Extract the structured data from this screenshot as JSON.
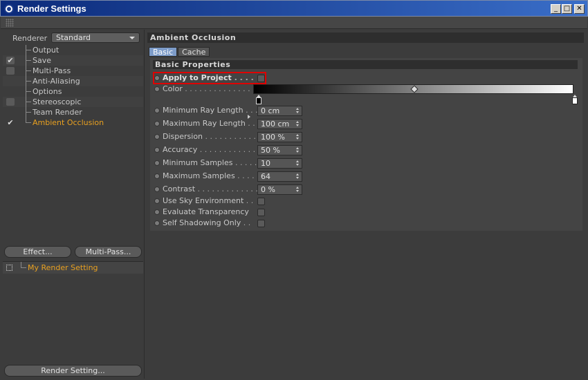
{
  "window": {
    "title": "Render Settings",
    "min_label": "_",
    "max_label": "□",
    "close_label": "✕"
  },
  "left": {
    "renderer_label": "Renderer",
    "renderer_value": "Standard",
    "tree": [
      {
        "label": "Output",
        "check": "",
        "active": false
      },
      {
        "label": "Save",
        "check": "✔",
        "active": false
      },
      {
        "label": "Multi-Pass",
        "check": "",
        "active": false
      },
      {
        "label": "Anti-Aliasing",
        "check": null,
        "active": false
      },
      {
        "label": "Options",
        "check": null,
        "active": false
      },
      {
        "label": "Stereoscopic",
        "check": "",
        "active": false
      },
      {
        "label": "Team Render",
        "check": null,
        "active": false
      },
      {
        "label": "Ambient Occlusion",
        "check": "✔",
        "active": true
      }
    ],
    "effect_button": "Effect...",
    "multipass_button": "Multi-Pass...",
    "setting_item": "My Render Setting",
    "render_setting_button": "Render Setting..."
  },
  "right": {
    "section_title": "Ambient Occlusion",
    "tabs": [
      "Basic",
      "Cache"
    ],
    "group_title": "Basic Properties",
    "apply_label": "Apply to Project",
    "color_label": "Color",
    "fields": [
      {
        "label": "Minimum Ray Length",
        "value": "0 cm"
      },
      {
        "label": "Maximum Ray Length",
        "value": "100 cm"
      },
      {
        "label": "Dispersion",
        "value": "100 %"
      },
      {
        "label": "Accuracy",
        "value": "50 %"
      },
      {
        "label": "Minimum Samples",
        "value": "10"
      },
      {
        "label": "Maximum Samples",
        "value": "64"
      },
      {
        "label": "Contrast",
        "value": "0 %"
      }
    ],
    "checkboxes": [
      {
        "label": "Use Sky Environment"
      },
      {
        "label": "Evaluate Transparency"
      },
      {
        "label": "Self Shadowing Only"
      }
    ]
  }
}
